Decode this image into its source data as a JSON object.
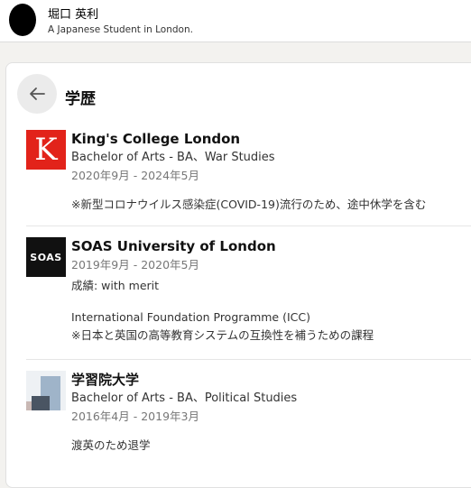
{
  "header": {
    "name": "堀口 英利",
    "headline": "A Japanese Student in London."
  },
  "section": {
    "title": "学歴",
    "back_icon": "arrow-left-icon"
  },
  "education": [
    {
      "logo_text": "K",
      "school": "King's College London",
      "degree": "Bachelor of Arts - BA、War Studies",
      "dates": "2020年9月 - 2024年5月",
      "note": "※新型コロナウイルス感染症(COVID-19)流行のため、途中休学を含む"
    },
    {
      "logo_text": "SOAS",
      "school": "SOAS University of London",
      "dates": "2019年9月 - 2020年5月",
      "grade": "成績: with merit",
      "program": "International Foundation Programme (ICC)",
      "program_note": "※日本と英国の高等教育システムの互換性を補うための課程"
    },
    {
      "school": "学習院大学",
      "degree": "Bachelor of Arts - BA、Political Studies",
      "dates": "2016年4月 - 2019年3月",
      "note": "渡英のため退学"
    }
  ],
  "colors": {
    "kcl_red": "#e2231a",
    "soas_black": "#111111",
    "background": "#f3f2ef"
  }
}
